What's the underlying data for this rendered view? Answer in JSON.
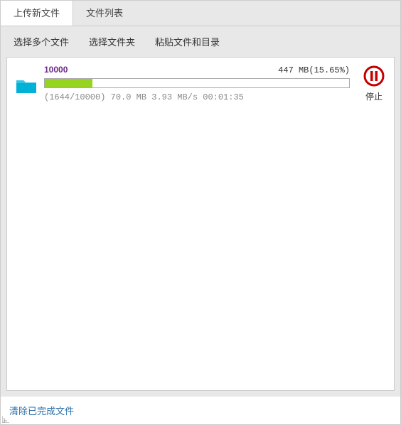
{
  "tabs": {
    "upload": "上传新文件",
    "list": "文件列表"
  },
  "toolbar": {
    "select_files": "选择多个文件",
    "select_folder": "选择文件夹",
    "paste": "粘贴文件和目录"
  },
  "upload": {
    "name": "10000",
    "size_text": "447 MB(15.65%)",
    "progress_count": "(1644/10000)",
    "uploaded": "70.0 MB",
    "speed": "3.93 MB/s",
    "eta": "00:01:35",
    "progress_percent": 15.65,
    "stop_label": "停止"
  },
  "footer": {
    "clear": "清除已完成文件"
  },
  "colors": {
    "progress": "#96d41f",
    "folder": "#00b3d6",
    "stop": "#c40000",
    "link": "#2b6ea8"
  }
}
